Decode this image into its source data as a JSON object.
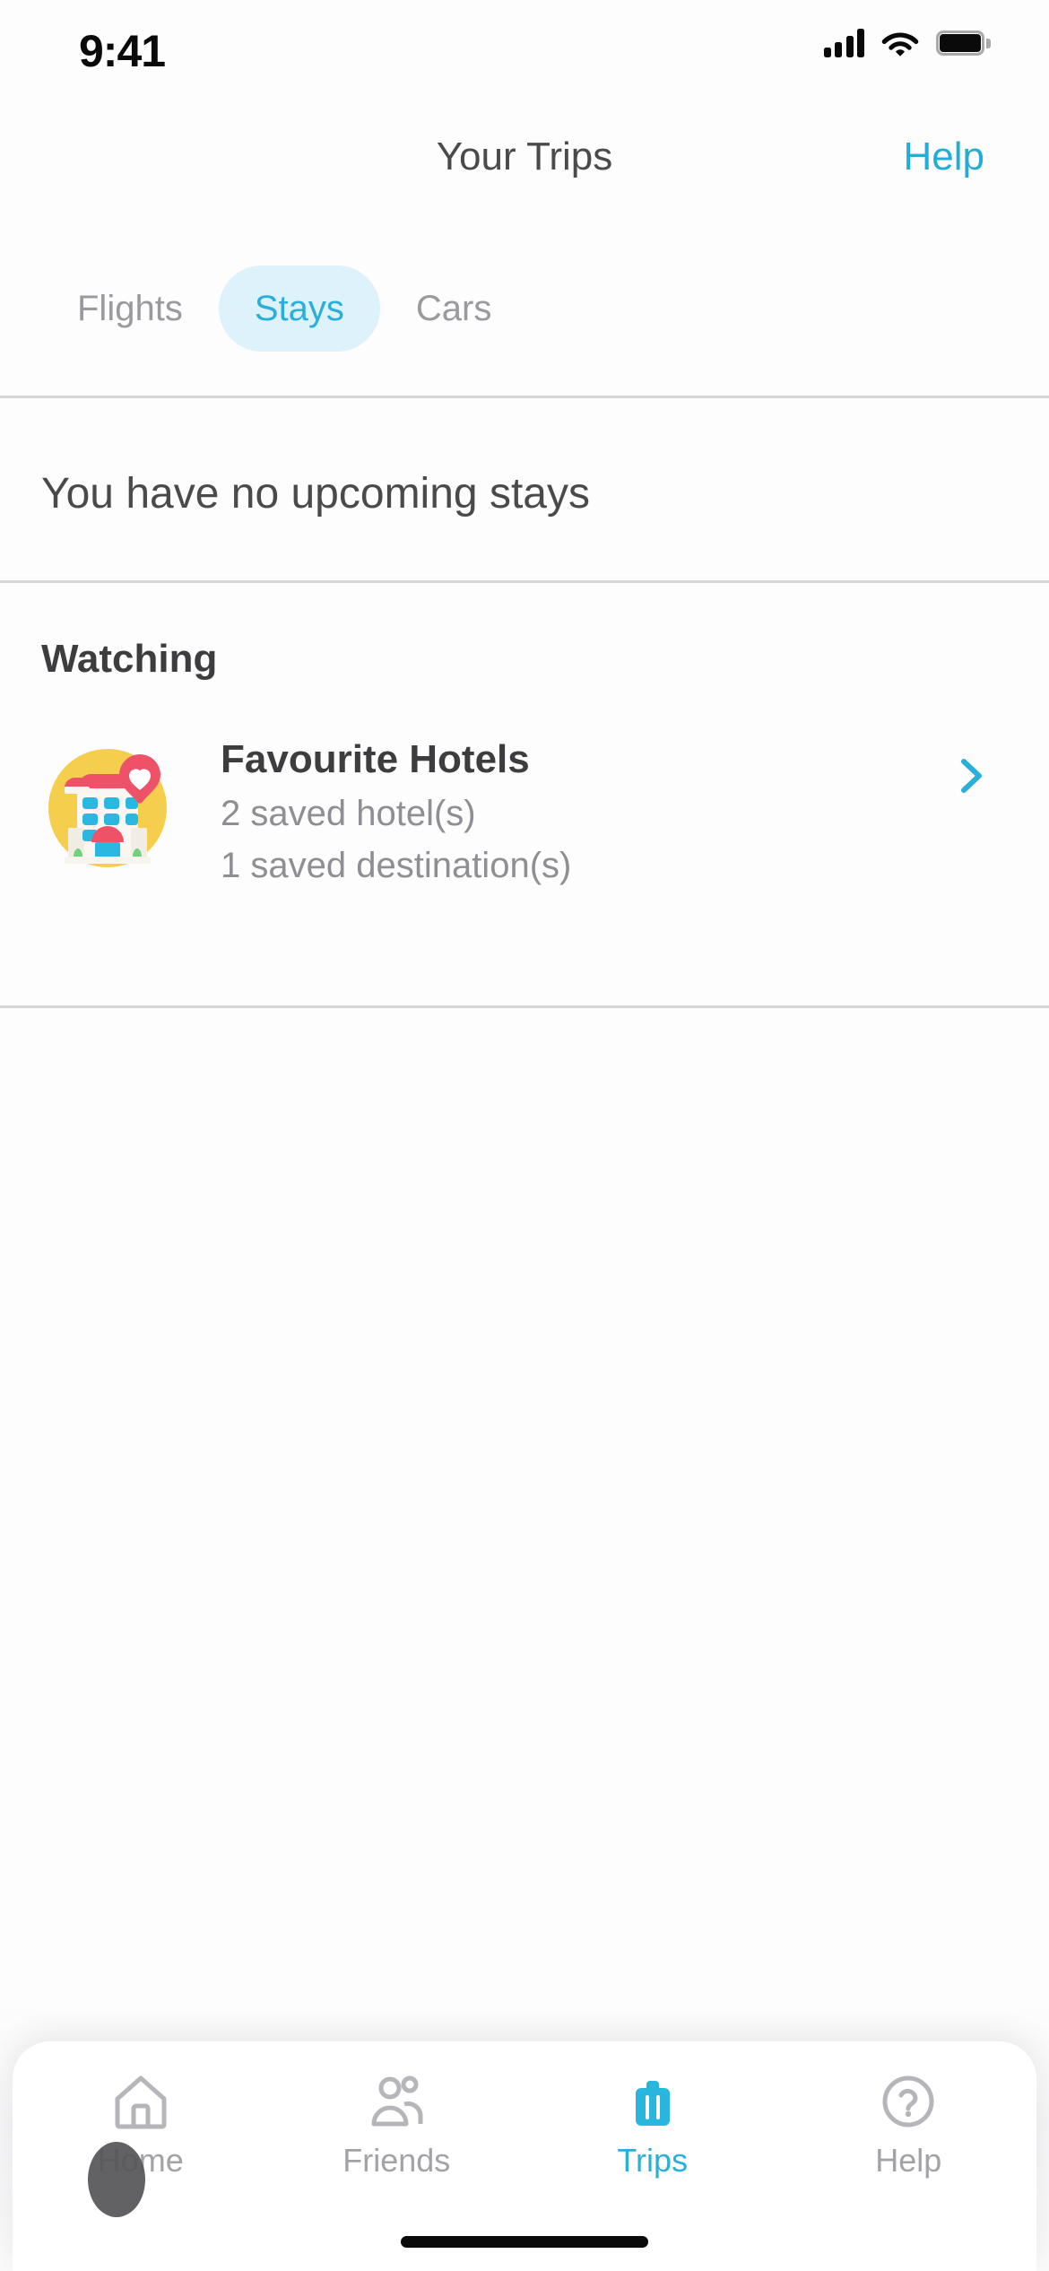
{
  "status_bar": {
    "time": "9:41",
    "signal_icon": "cellular-signal-icon",
    "wifi_icon": "wifi-icon",
    "battery_icon": "battery-full-icon"
  },
  "header": {
    "title": "Your Trips",
    "action_label": "Help",
    "accent_color": "#24ADD4"
  },
  "tabs": {
    "items": [
      {
        "label": "Flights",
        "active": false
      },
      {
        "label": "Stays",
        "active": true
      },
      {
        "label": "Cars",
        "active": false
      }
    ],
    "active_color": "#29AFDA",
    "active_pill_bg": "#DDF2FB",
    "inactive_color": "#9A9A9E"
  },
  "empty_state": {
    "message": "You have no upcoming stays"
  },
  "watching": {
    "section_title": "Watching",
    "items": [
      {
        "title": "Favourite Hotels",
        "subtitle_1": "2 saved hotel(s)",
        "subtitle_2": "1 saved destination(s)",
        "thumb_icon": "favourite-hotel-illustration",
        "thumb_bg_color": "#F4CE4C",
        "heart_badge_color": "#EE5268",
        "chevron_icon": "chevron-right-icon",
        "chevron_color": "#29AFDA"
      }
    ]
  },
  "bottom_nav": {
    "items": [
      {
        "label": "Home",
        "icon": "home-icon",
        "active": false
      },
      {
        "label": "Friends",
        "icon": "friends-icon",
        "active": false
      },
      {
        "label": "Trips",
        "icon": "suitcase-icon",
        "active": true
      },
      {
        "label": "Help",
        "icon": "help-circle-icon",
        "active": false
      }
    ],
    "active_color": "#29AFDA",
    "inactive_color": "#A3A3A7"
  },
  "home_indicator": {
    "label": "home-indicator"
  }
}
